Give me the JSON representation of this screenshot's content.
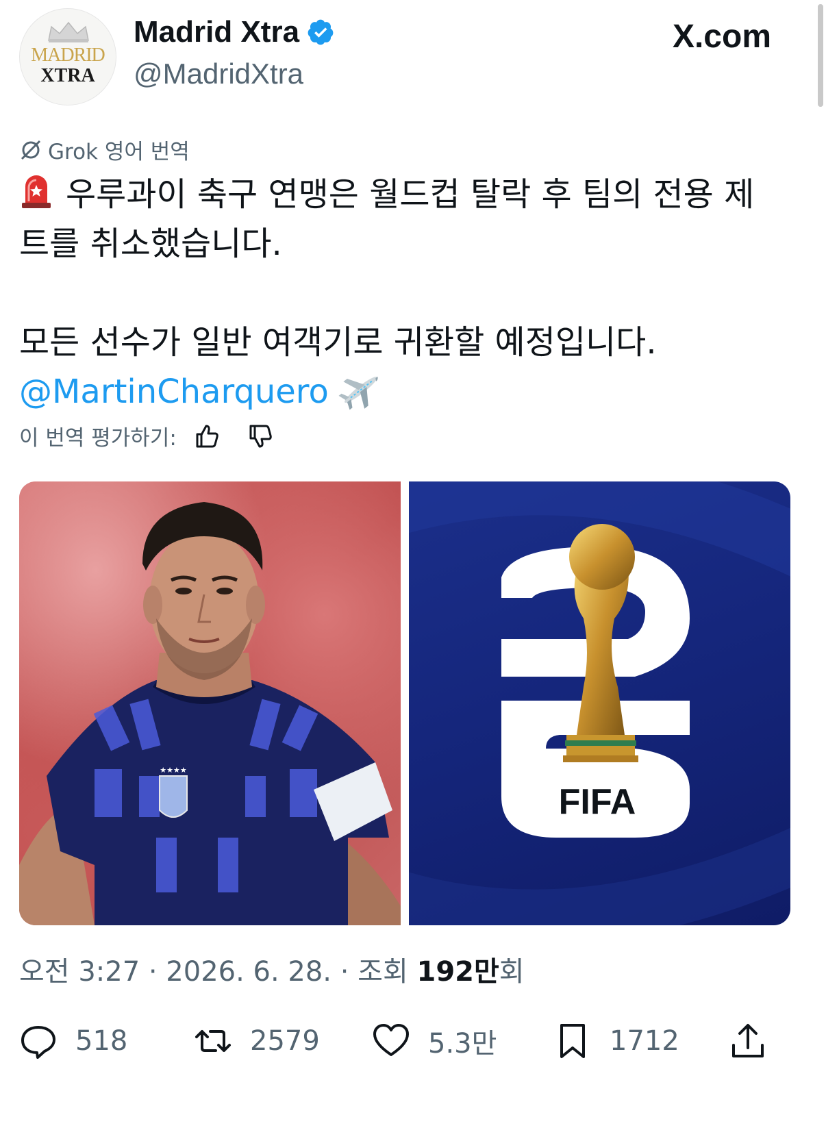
{
  "header": {
    "avatar_text_top": "MADRID",
    "avatar_text_bottom": "XTRA",
    "display_name": "Madrid Xtra",
    "handle": "@MadridXtra",
    "brand": "X.com"
  },
  "translation": {
    "label": "Grok 영어 번역",
    "rate_label": "이 번역 평가하기:"
  },
  "tweet": {
    "line1": "우루과이 축구 연맹은 월드컵 탈락 후 팀의 전용 제",
    "line2": "트를 취소했습니다.",
    "line3": "모든 선수가 일반 여객기로 귀환할 예정입니다.",
    "mention": "@MartinCharquero"
  },
  "media": {
    "left_jersey_text": "★★★★",
    "right_logo_text": "FIFA"
  },
  "meta": {
    "time": "오전 3:27",
    "date": "2026. 6. 28.",
    "views_prefix": "조회",
    "views_count": "192만",
    "views_suffix": "회"
  },
  "actions": {
    "replies": "518",
    "reposts": "2579",
    "likes": "5.3만",
    "bookmarks": "1712"
  },
  "colors": {
    "accent": "#1d9bf0",
    "text_primary": "#0f1419",
    "text_secondary": "#536471"
  }
}
